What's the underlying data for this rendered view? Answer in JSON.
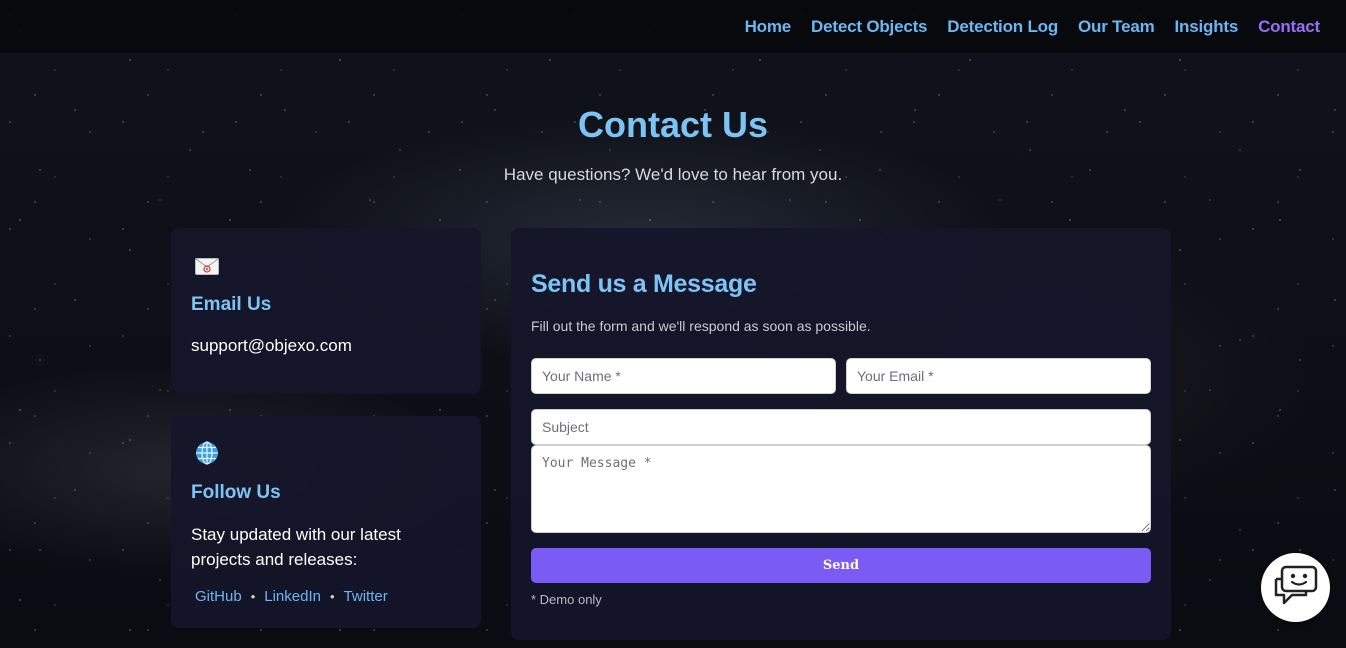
{
  "nav": {
    "links": [
      {
        "label": "Home"
      },
      {
        "label": "Detect Objects"
      },
      {
        "label": "Detection Log"
      },
      {
        "label": "Our Team"
      },
      {
        "label": "Insights"
      },
      {
        "label": "Contact",
        "active": true
      }
    ]
  },
  "header": {
    "title": "Contact Us",
    "subtitle": "Have questions? We'd love to hear from you."
  },
  "email_card": {
    "icon": "envelope-icon",
    "heading": "Email Us",
    "address": "support@objexo.com"
  },
  "follow_card": {
    "icon": "globe-icon",
    "heading": "Follow Us",
    "text": "Stay updated with our latest projects and releases:",
    "links": [
      "GitHub",
      "LinkedIn",
      "Twitter"
    ],
    "separator": "•"
  },
  "form": {
    "heading": "Send us a Message",
    "description": "Fill out the form and we'll respond as soon as possible.",
    "name_placeholder": "Your Name *",
    "email_placeholder": "Your Email *",
    "subject_placeholder": "Subject",
    "message_placeholder": "Your Message *",
    "send_label": "Send",
    "note": "* Demo only"
  },
  "chat": {
    "icon": "chatbot-icon"
  },
  "colors": {
    "accent_blue": "#7cc4f5",
    "link_blue": "#6cb6f2",
    "active_purple": "#9b6cf5",
    "button_purple": "#7a5cf5",
    "card_bg": "#16162a"
  }
}
